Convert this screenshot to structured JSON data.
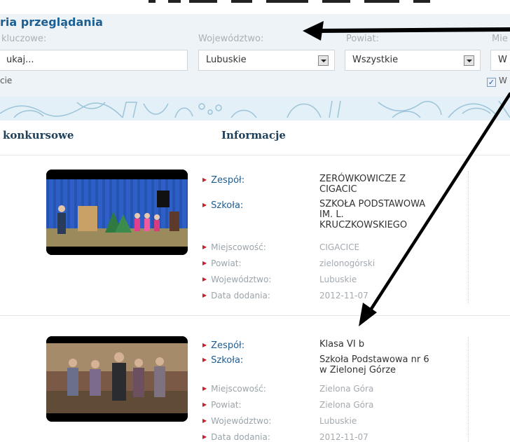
{
  "filter": {
    "title": "ria przeglądania",
    "labels": {
      "keywords": "kluczowe:",
      "voivodeship": "Województwo:",
      "district": "Powiat:",
      "city": "Mie"
    },
    "search_value": "ukaj...",
    "voivodeship_value": "Lubuskie",
    "district_value": "Wszystkie",
    "city_value": "W",
    "option_left": "cie",
    "checkbox_label": "W",
    "checkbox_checked": true
  },
  "columns": {
    "left": "konkursowe",
    "info": "Informacje"
  },
  "entries": [
    {
      "team_label": "Zespół:",
      "team_value": [
        "ZERÓWKOWICZE Z",
        "CIGACIC"
      ],
      "school_label": "Szkoła:",
      "school_value": [
        "SZKOŁA PODSTAWOWA",
        "IM. L.",
        "KRUCZKOWSKIEGO"
      ],
      "city_label": "Miejscowość:",
      "city_value": "CIGACICE",
      "district_label": "Powiat:",
      "district_value": "zielonogórski",
      "voivodeship_label": "Województwo:",
      "voivodeship_value": "Lubuskie",
      "date_label": "Data dodania:",
      "date_value": "2012-11-07"
    },
    {
      "team_label": "Zespół:",
      "team_value": [
        "Klasa VI b"
      ],
      "school_label": "Szkoła:",
      "school_value": [
        "Szkoła Podstawowa nr 6",
        "w Zielonej Górze"
      ],
      "city_label": "Miejscowość:",
      "city_value": "Zielona Góra",
      "district_label": "Powiat:",
      "district_value": "Zielona Góra",
      "voivodeship_label": "Województwo:",
      "voivodeship_value": "Lubuskie",
      "date_label": "Data dodania:",
      "date_value": "2012-11-07"
    }
  ]
}
